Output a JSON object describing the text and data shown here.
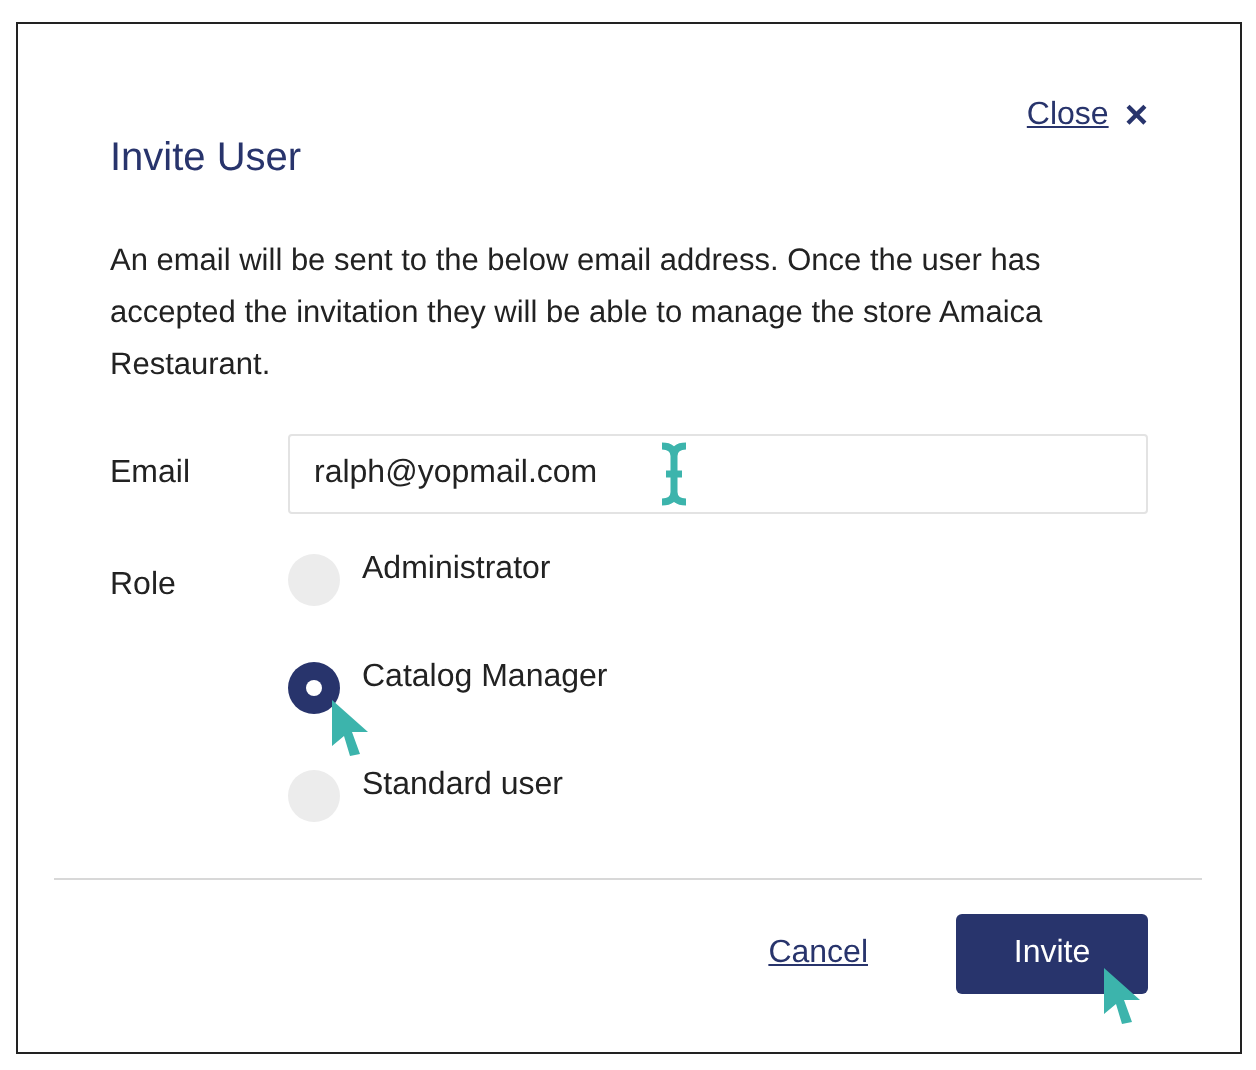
{
  "dialog": {
    "title": "Invite User",
    "close": {
      "label": "Close",
      "icon": "×"
    },
    "message": "An email will be sent to the below email address. Once the user has accepted the invitation they will be able to manage the store Amaica Restaurant.",
    "email": {
      "label": "Email",
      "value": "ralph@yopmail.com"
    },
    "role": {
      "label": "Role",
      "options": [
        {
          "label": "Administrator",
          "selected": false
        },
        {
          "label": "Catalog Manager",
          "selected": true
        },
        {
          "label": "Standard user",
          "selected": false
        }
      ]
    },
    "buttons": [
      {
        "kind": "link",
        "label": "Cancel"
      },
      {
        "kind": "primary",
        "label": "Invite"
      }
    ]
  }
}
